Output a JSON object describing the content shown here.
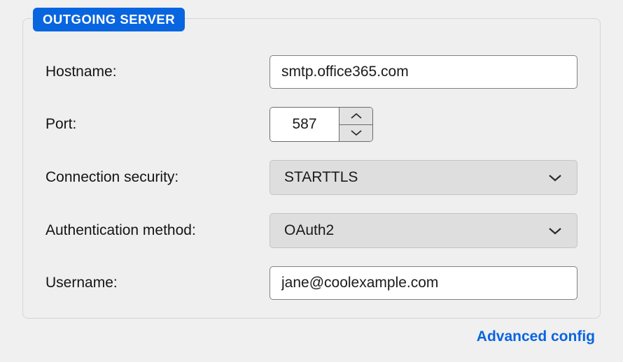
{
  "outgoing": {
    "legend": "OUTGOING SERVER",
    "hostname_label": "Hostname:",
    "hostname_value": "smtp.office365.com",
    "port_label": "Port:",
    "port_value": "587",
    "security_label": "Connection security:",
    "security_value": "STARTTLS",
    "auth_label": "Authentication method:",
    "auth_value": "OAuth2",
    "username_label": "Username:",
    "username_value": "jane@coolexample.com"
  },
  "footer": {
    "advanced_label": "Advanced config"
  },
  "colors": {
    "accent": "#0865e0"
  }
}
